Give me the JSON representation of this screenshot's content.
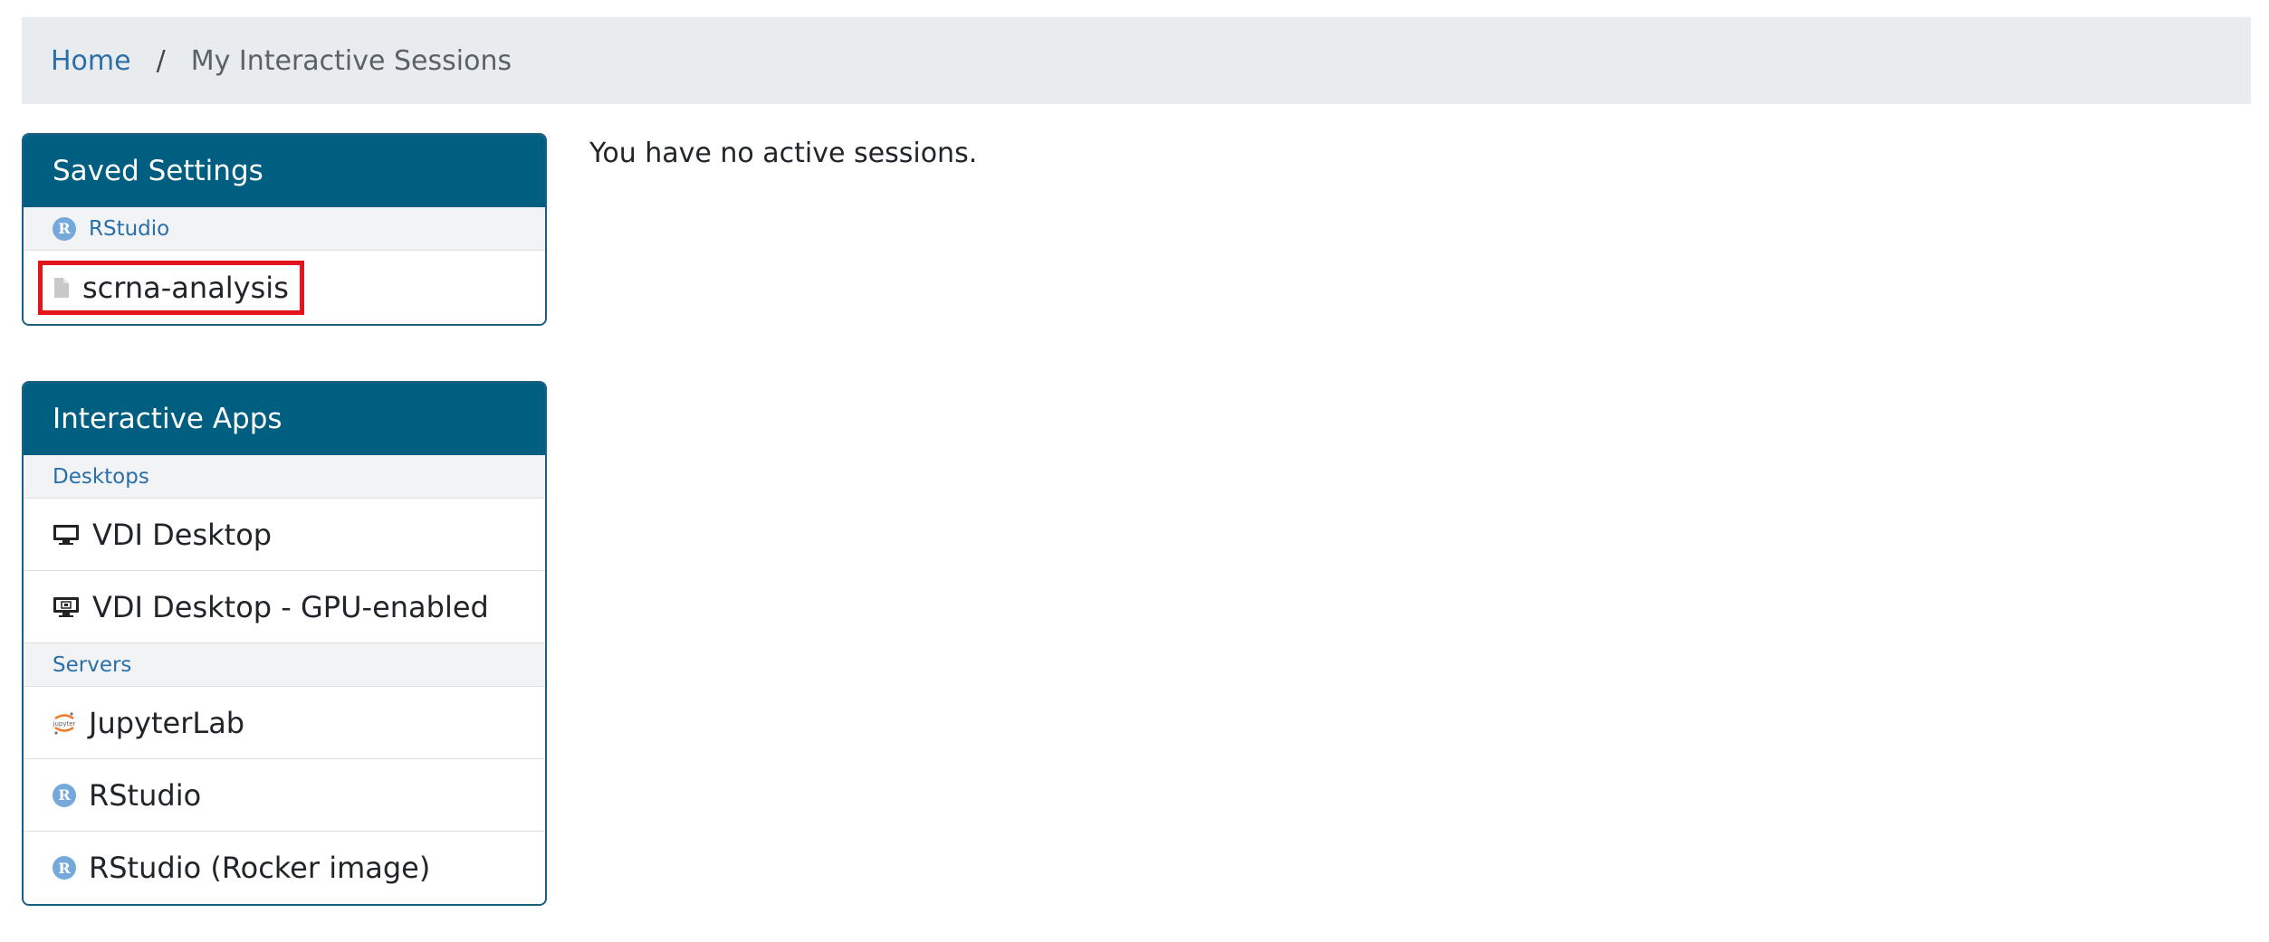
{
  "breadcrumb": {
    "home": "Home",
    "separator": "/",
    "current": "My Interactive Sessions"
  },
  "main": {
    "message": "You have no active sessions."
  },
  "saved_settings": {
    "title": "Saved Settings",
    "group": "RStudio",
    "item": "scrna-analysis"
  },
  "interactive_apps": {
    "title": "Interactive Apps",
    "groups": [
      {
        "label": "Desktops",
        "items": [
          {
            "label": "VDI Desktop",
            "icon": "desktop-icon"
          },
          {
            "label": "VDI Desktop - GPU-enabled",
            "icon": "gpu-desktop-icon"
          }
        ]
      },
      {
        "label": "Servers",
        "items": [
          {
            "label": "JupyterLab",
            "icon": "jupyter-icon"
          },
          {
            "label": "RStudio",
            "icon": "rstudio-icon"
          },
          {
            "label": "RStudio (Rocker image)",
            "icon": "rstudio-icon"
          }
        ]
      }
    ]
  },
  "colors": {
    "header_bg": "#005e80",
    "link": "#2a6fa8",
    "highlight": "#e3141b"
  }
}
